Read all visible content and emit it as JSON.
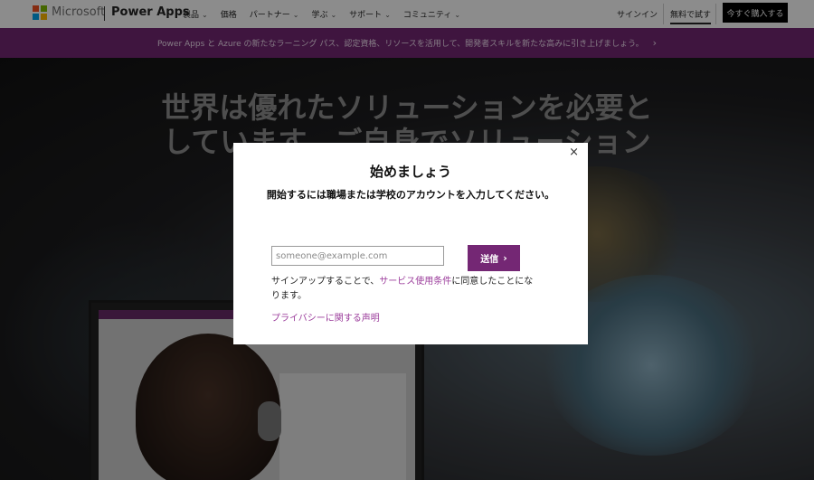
{
  "header": {
    "brand_company": "Microsoft",
    "brand_product": "Power Apps",
    "menu": [
      {
        "label": "製品",
        "has_dropdown": true
      },
      {
        "label": "価格",
        "has_dropdown": false
      },
      {
        "label": "パートナー",
        "has_dropdown": true
      },
      {
        "label": "学ぶ",
        "has_dropdown": true
      },
      {
        "label": "サポート",
        "has_dropdown": true
      },
      {
        "label": "コミュニティ",
        "has_dropdown": true
      }
    ],
    "sign_in": "サインイン",
    "free_trial": "無料で試す",
    "buy_now": "今すぐ購入する"
  },
  "banner": {
    "text": "Power Apps と Azure の新たなラーニング パス、認定資格、リソースを活用して、開発者スキルを新たな高みに引き上げましょう。",
    "arrow": "›"
  },
  "hero": {
    "title": "世界は優れたソリューションを必要としています。ご自身でソリューションを作りましょう。"
  },
  "modal": {
    "close": "×",
    "title": "始めましょう",
    "subtitle": "開始するには職場または学校のアカウントを入力してください。",
    "email_placeholder": "someone@example.com",
    "email_value": "",
    "submit_label": "送信",
    "terms_prefix": "サインアップすることで、",
    "terms_link": "サービス使用条件",
    "terms_suffix": "に同意したことになります。",
    "privacy_link": "プライバシーに関する声明"
  },
  "colors": {
    "accent": "#742774",
    "link": "#9b3c9b",
    "logo": [
      "#f25022",
      "#7fba00",
      "#00a4ef",
      "#ffb900"
    ]
  }
}
